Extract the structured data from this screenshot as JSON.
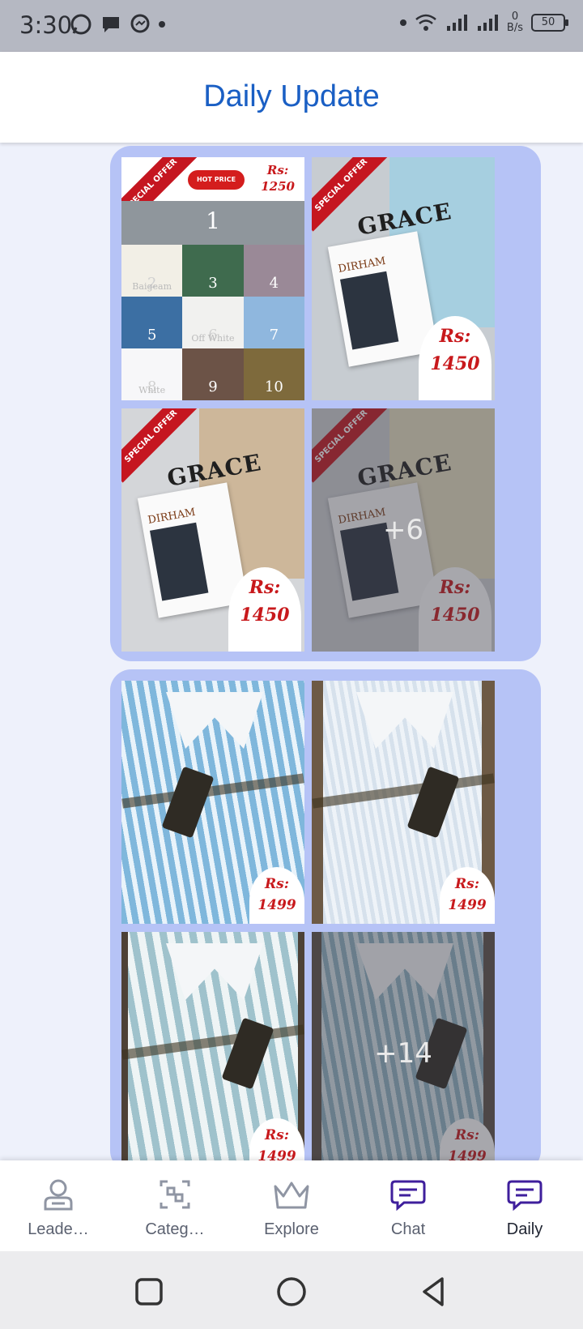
{
  "status_bar": {
    "time": "3:30",
    "net_speed_value": "0",
    "net_speed_unit": "B/s",
    "battery": "50"
  },
  "header": {
    "title": "Daily Update"
  },
  "posts": [
    {
      "images": [
        {
          "kind": "swatch-chart",
          "hot_label": "HOT PRICE",
          "price_label": "Rs:",
          "price": "1250",
          "ribbon": "SPECIAL OFFER",
          "swatches": [
            {
              "label": "1",
              "color": "#8f969c"
            },
            {
              "label": "2",
              "color": "#f2efe6",
              "name": "Baigeam"
            },
            {
              "label": "3",
              "color": "#3f6b4e"
            },
            {
              "label": "4",
              "color": "#9a8997"
            },
            {
              "label": "5",
              "color": "#3c6fa3"
            },
            {
              "label": "6",
              "color": "#f1f1ef",
              "name": "Off White"
            },
            {
              "label": "7",
              "color": "#8fb7de"
            },
            {
              "label": "8",
              "color": "#f7f7f9",
              "name": "White"
            },
            {
              "label": "9",
              "color": "#6c5347"
            },
            {
              "label": "10",
              "color": "#7e6a3c"
            }
          ]
        },
        {
          "kind": "product",
          "ribbon": "SPECIAL OFFER",
          "brand": "GRACE",
          "poster": "DIRHAM",
          "price_label": "Rs:",
          "price": "1450",
          "fabric_color": "#a6cfe0"
        },
        {
          "kind": "product",
          "ribbon": "SPECIAL OFFER",
          "brand": "GRACE",
          "poster": "DIRHAM",
          "price_label": "Rs:",
          "price": "1450",
          "fabric_color": "#cdb79a"
        },
        {
          "kind": "product",
          "ribbon": "SPECIAL OFFER",
          "brand": "GRACE",
          "poster": "DIRHAM",
          "price_label": "Rs:",
          "price": "1450",
          "fabric_color": "#e8e0c2",
          "more_count": "+6"
        }
      ]
    },
    {
      "images": [
        {
          "kind": "shirt",
          "shirt_color": "#7fb7dc",
          "price_label": "Rs:",
          "price": "1499"
        },
        {
          "kind": "shirt",
          "shirt_color": "#d6e1ec",
          "price_label": "Rs:",
          "price": "1499"
        },
        {
          "kind": "shirt",
          "shirt_color": "#c9dde3",
          "price_label": "Rs:",
          "price": "1499"
        },
        {
          "kind": "shirt",
          "shirt_color": "#8fb3c4",
          "price_label": "Rs:",
          "price": "1499",
          "more_count": "+14"
        }
      ]
    }
  ],
  "bottom_nav": {
    "items": [
      {
        "label": "Leade…",
        "icon": "user-icon",
        "color": "#8f95a3"
      },
      {
        "label": "Categ…",
        "icon": "categories-icon",
        "color": "#8f95a3"
      },
      {
        "label": "Explore",
        "icon": "crown-icon",
        "color": "#8f95a3"
      },
      {
        "label": "Chat",
        "icon": "chat-icon",
        "color": "#3f1f9c"
      },
      {
        "label": "Daily",
        "icon": "daily-icon",
        "color": "#3f1f9c"
      }
    ],
    "active": "Daily"
  },
  "colors": {
    "accent": "#1a5fc4",
    "card_bg": "#b6c3f6",
    "price_red": "#c8191c",
    "ribbon_red": "#c51620"
  }
}
